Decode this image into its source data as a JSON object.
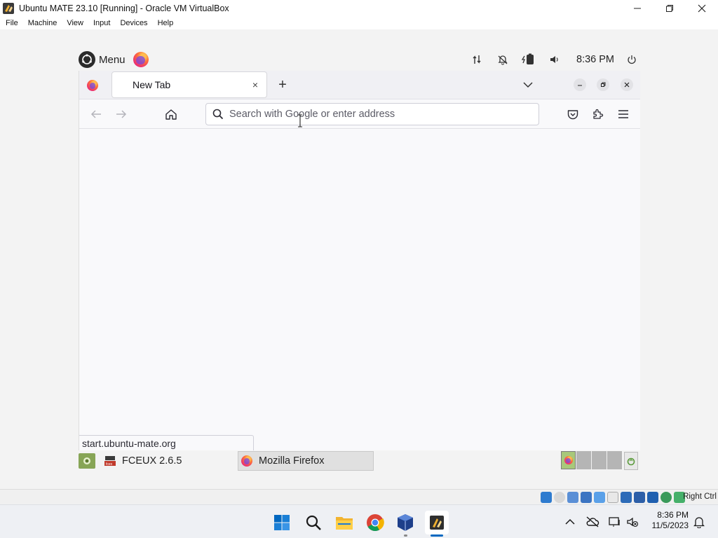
{
  "host_window": {
    "title": "Ubuntu MATE 23.10 [Running] - Oracle VM VirtualBox",
    "controls": [
      "minimize",
      "maximize",
      "close"
    ],
    "menu": [
      "File",
      "Machine",
      "View",
      "Input",
      "Devices",
      "Help"
    ]
  },
  "mate_top_panel": {
    "menu_label": "Menu",
    "tray_icons": [
      "network-icon",
      "notification-icon",
      "battery-icon",
      "volume-icon"
    ],
    "clock": "8:36 PM",
    "power_icon": "power-icon"
  },
  "firefox": {
    "tab": {
      "title": "New Tab",
      "close": "×"
    },
    "new_tab": "+",
    "urlbar": {
      "placeholder": "Search with Google or enter address",
      "value": ""
    },
    "status_text": "start.ubuntu-mate.org"
  },
  "mate_bottom_panel": {
    "tasks": [
      {
        "label": "FCEUX 2.6.5",
        "active": false
      },
      {
        "label": "Mozilla Firefox",
        "active": true
      }
    ],
    "workspaces": 4,
    "active_workspace": 1
  },
  "vbox_status": {
    "host_key": "Right Ctrl"
  },
  "windows_taskbar": {
    "apps": [
      "start-icon",
      "search-icon",
      "file-explorer-icon",
      "chrome-icon",
      "virtualbox-icon",
      "virtualbox-vm-icon"
    ],
    "clock_time": "8:36 PM",
    "clock_date": "11/5/2023"
  },
  "colors": {
    "firefox_orange": "#ff7139",
    "mate_green": "#87a556",
    "win_blue": "#0067c0"
  }
}
